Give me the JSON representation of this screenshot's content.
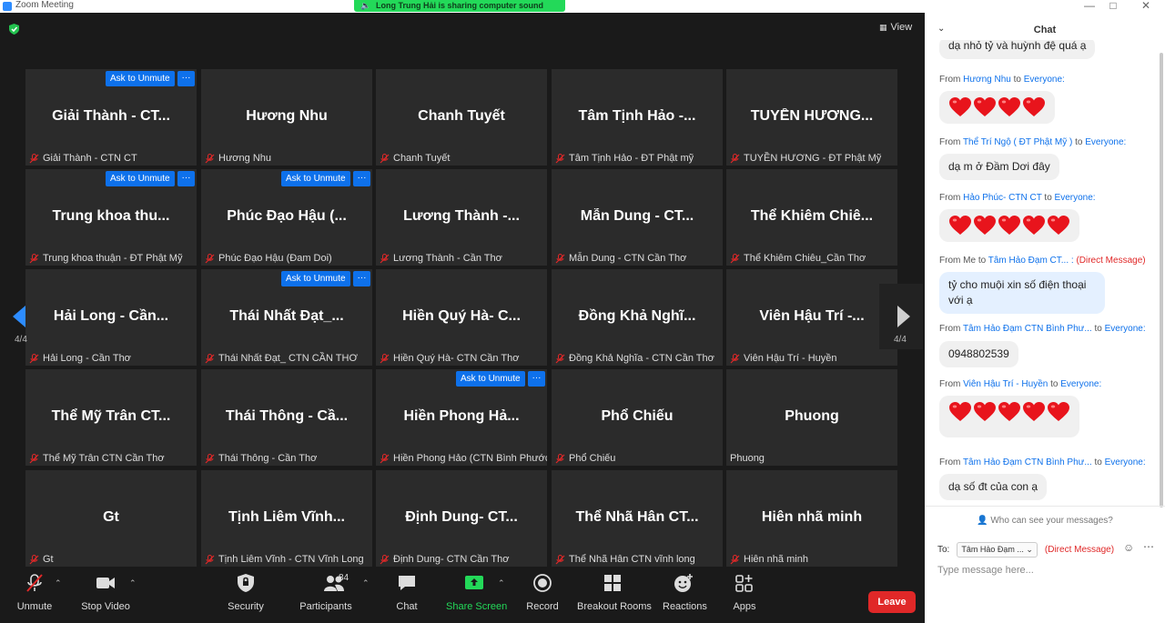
{
  "window": {
    "title": "Zoom Meeting"
  },
  "share_banner": "Long Trung Hải is sharing computer sound",
  "view_label": "View",
  "unmute_label": "Ask to Unmute",
  "more_label": "···",
  "page_indicator": "4/4",
  "tiles": [
    {
      "big": "Giải Thành - CT...",
      "small": "Giải Thành - CTN CT",
      "unmute": true
    },
    {
      "big": "Hương Nhu",
      "small": "Hương Nhu",
      "unmute": false
    },
    {
      "big": "Chanh Tuyết",
      "small": "Chanh Tuyết",
      "unmute": false
    },
    {
      "big": "Tâm Tịnh Hảo -...",
      "small": "Tâm Tịnh Hảo - ĐT Phật mỹ",
      "unmute": false
    },
    {
      "big": "TUYỀN HƯƠNG...",
      "small": "TUYỀN HƯƠNG - ĐT Phật Mỹ",
      "unmute": false
    },
    {
      "big": "Trung khoa thu...",
      "small": "Trung khoa thuận - ĐT Phật Mỹ",
      "unmute": true
    },
    {
      "big": "Phúc Đạo Hậu (...",
      "small": "Phúc Đạo Hậu (Đam Doi)",
      "unmute": true
    },
    {
      "big": "Lương Thành -...",
      "small": "Lương Thành - Cần Thơ",
      "unmute": false
    },
    {
      "big": "Mẫn Dung - CT...",
      "small": "Mẫn Dung - CTN Cần Thơ",
      "unmute": false
    },
    {
      "big": "Thể Khiêm Chiê...",
      "small": "Thể Khiêm Chiêu_Cần Thơ",
      "unmute": false
    },
    {
      "big": "Hải Long - Cần...",
      "small": "Hải Long - Cần Thơ",
      "unmute": false
    },
    {
      "big": "Thái Nhất Đạt_...",
      "small": "Thái Nhất Đạt_ CTN CẦN THƠ",
      "unmute": true
    },
    {
      "big": "Hiền Quý Hà- C...",
      "small": "Hiền Quý Hà- CTN Cần Thơ",
      "unmute": false
    },
    {
      "big": "Đồng Khả Nghĩ...",
      "small": "Đồng Khả Nghĩa - CTN Cần Thơ",
      "unmute": false
    },
    {
      "big": "Viên Hậu Trí -...",
      "small": "Viên Hậu Trí - Huyền",
      "unmute": false
    },
    {
      "big": "Thể Mỹ Trân CT...",
      "small": "Thể Mỹ Trân CTN Cần Thơ",
      "unmute": false
    },
    {
      "big": "Thái Thông - Cầ...",
      "small": "Thái Thông - Cần Thơ",
      "unmute": false
    },
    {
      "big": "Hiền Phong Hả...",
      "small": "Hiền Phong Hảo (CTN Bình Phước)",
      "unmute": true
    },
    {
      "big": "Phổ Chiếu",
      "small": "Phổ Chiếu",
      "unmute": false
    },
    {
      "big": "Phuong",
      "small": "Phuong",
      "unmute": false,
      "nomic": true
    },
    {
      "big": "Gt",
      "small": "Gt",
      "unmute": false
    },
    {
      "big": "Tịnh Liêm Vĩnh...",
      "small": "Tịnh Liêm Vĩnh - CTN Vĩnh Long",
      "unmute": false
    },
    {
      "big": "Định Dung- CT...",
      "small": "Định Dung- CTN Cần Thơ",
      "unmute": false
    },
    {
      "big": "Thể Nhã Hân CT...",
      "small": "Thể Nhã Hân CTN vĩnh long",
      "unmute": false
    },
    {
      "big": "Hiên nhã minh",
      "small": "Hiên nhã minh",
      "unmute": false
    }
  ],
  "toolbar": {
    "unmute": "Unmute",
    "stop_video": "Stop Video",
    "security": "Security",
    "participants": "Participants",
    "participants_count": "84",
    "chat": "Chat",
    "share_screen": "Share Screen",
    "record": "Record",
    "breakout_rooms": "Breakout Rooms",
    "reactions": "Reactions",
    "apps": "Apps",
    "leave": "Leave"
  },
  "chat": {
    "title": "Chat",
    "top_partial": "dạ nhỏ tỷ và huỳnh đệ quá ạ",
    "m1": {
      "from": "Hương Nhu",
      "to": "Everyone:"
    },
    "m2": {
      "from": "Thể Trí Ngộ ( ĐT Phật Mỹ )",
      "to": "Everyone:",
      "text": "dạ m ở Đầm Dơi đây"
    },
    "m3": {
      "from": "Hảo Phúc- CTN CT",
      "to": "Everyone:"
    },
    "m4": {
      "from": "Me",
      "to": "Tâm Hảo Đạm CT... :",
      "tag": "(Direct Message)",
      "text1": "tỷ cho muội xin số điện thoại",
      "text2": "với ạ"
    },
    "m5": {
      "from": "Tâm Hảo Đạm CTN Bình Phư...",
      "to": "Everyone:",
      "text": "0948802539"
    },
    "m6": {
      "from": "Viên Hậu Trí  - Huyền",
      "to": "Everyone:"
    },
    "m7": {
      "from": "Tâm Hảo Đạm CTN Bình Phư...",
      "to": "Everyone:",
      "text": "dạ số đt của con ạ"
    },
    "from_word": "From",
    "to_word": "to",
    "who_see": "Who can see your messages?",
    "to_label": "To:",
    "recipient": "Tâm Hảo Đạm ...",
    "direct_message": "(Direct Message)",
    "input_placeholder": "Type message here..."
  },
  "colors": {
    "accent": "#0e71eb",
    "share_green": "#23d959",
    "leave_red": "#e02828",
    "tile_bg": "#2b2b2b"
  }
}
